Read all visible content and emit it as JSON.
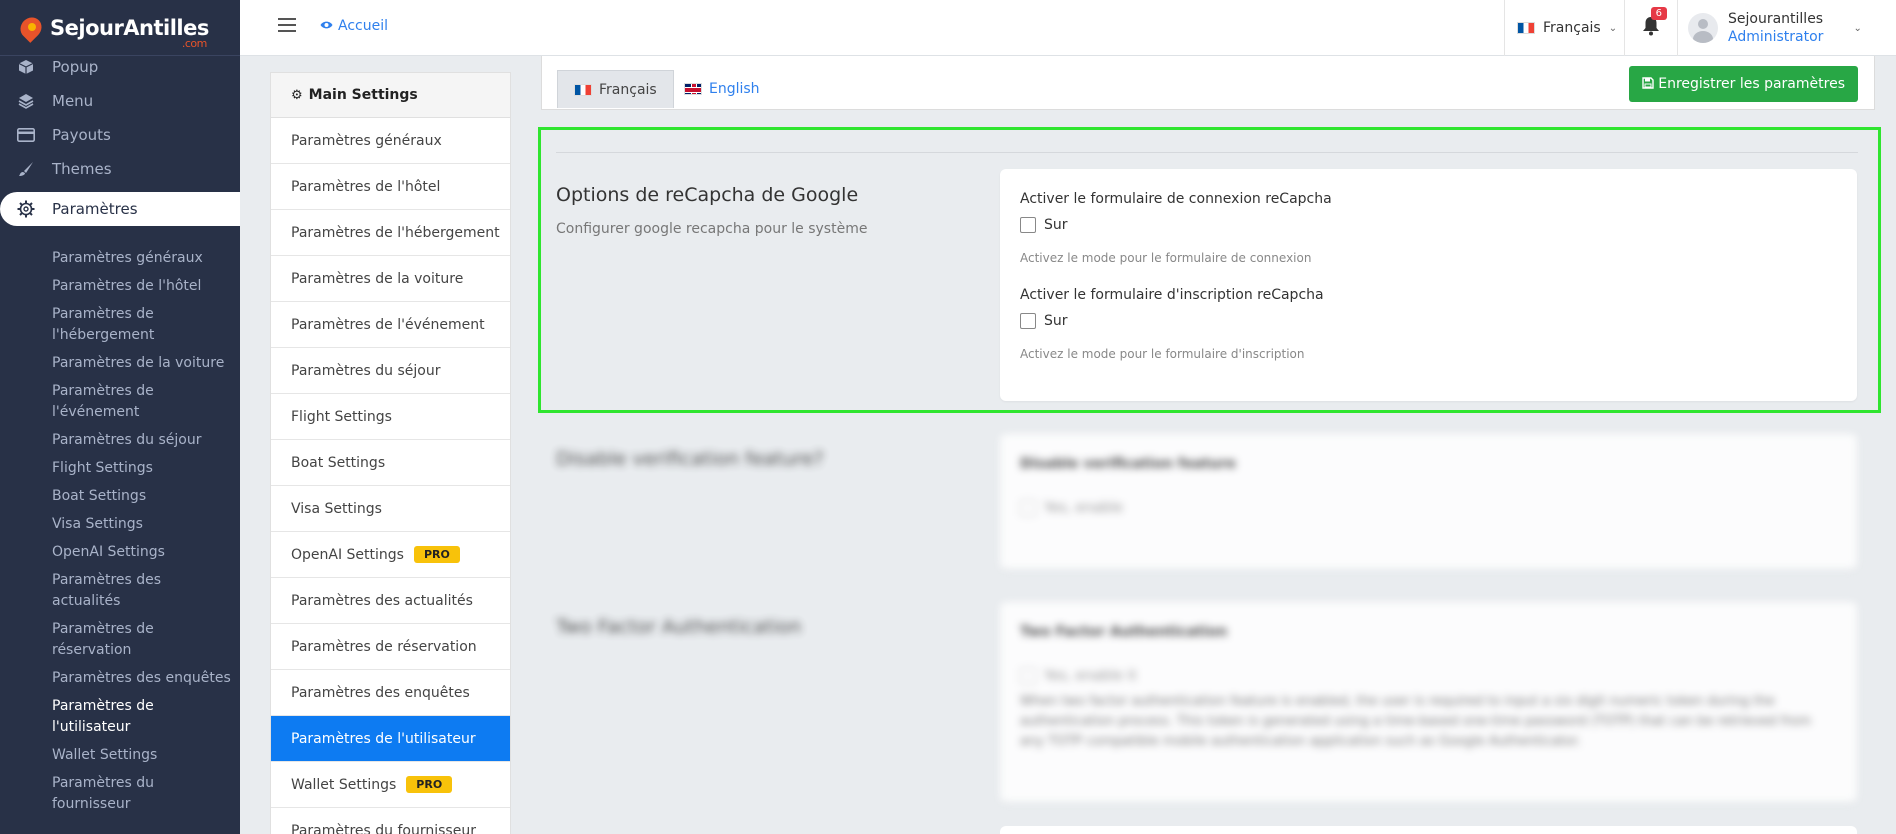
{
  "brand": {
    "name": "SejourAntilles",
    "suffix": ".com"
  },
  "sidebar": {
    "top_items": [
      {
        "label": "Popup",
        "icon": "cube-icon"
      },
      {
        "label": "Menu",
        "icon": "layers-icon"
      },
      {
        "label": "Payouts",
        "icon": "credit-card-icon"
      },
      {
        "label": "Themes",
        "icon": "brush-icon"
      }
    ],
    "active_item": {
      "label": "Paramètres",
      "icon": "gear-icon"
    },
    "sub_items": [
      "Paramètres généraux",
      "Paramètres de l'hôtel",
      "Paramètres de l'hébergement",
      "Paramètres de la voiture",
      "Paramètres de l'événement",
      "Paramètres du séjour",
      "Flight Settings",
      "Boat Settings",
      "Visa Settings",
      "OpenAI Settings",
      "Paramètres des actualités",
      "Paramètres de réservation",
      "Paramètres des enquêtes",
      "Paramètres de l'utilisateur",
      "Wallet Settings",
      "Paramètres du fournisseur"
    ]
  },
  "topbar": {
    "home_label": "Accueil",
    "language": "Français",
    "notifications_count": "6",
    "user_name": "Sejourantilles",
    "user_role": "Administrator"
  },
  "settings_menu": {
    "header": "Main Settings",
    "items": [
      {
        "label": "Paramètres généraux"
      },
      {
        "label": "Paramètres de l'hôtel"
      },
      {
        "label": "Paramètres de l'hébergement"
      },
      {
        "label": "Paramètres de la voiture"
      },
      {
        "label": "Paramètres de l'événement"
      },
      {
        "label": "Paramètres du séjour"
      },
      {
        "label": "Flight Settings"
      },
      {
        "label": "Boat Settings"
      },
      {
        "label": "Visa Settings"
      },
      {
        "label": "OpenAI Settings",
        "badge": "PRO"
      },
      {
        "label": "Paramètres des actualités"
      },
      {
        "label": "Paramètres de réservation"
      },
      {
        "label": "Paramètres des enquêtes"
      },
      {
        "label": "Paramètres de l'utilisateur",
        "active": true
      },
      {
        "label": "Wallet Settings",
        "badge": "PRO"
      },
      {
        "label": "Paramètres du fournisseur"
      }
    ]
  },
  "panel": {
    "tabs": [
      "Français",
      "English"
    ],
    "save_label": "Enregistrer les paramètres",
    "recaptcha": {
      "title": "Options de reCapcha de Google",
      "desc": "Configurer google recapcha pour le système",
      "login_label": "Activer le formulaire de connexion reCapcha",
      "login_check": "Sur",
      "login_help": "Activez le mode pour le formulaire de connexion",
      "register_label": "Activer le formulaire d'inscription reCapcha",
      "register_check": "Sur",
      "register_help": "Activez le mode pour le formulaire d'inscription"
    },
    "verification": {
      "title": "Disable verification feature?",
      "label": "Disable verification feature",
      "check": "Yes, enable"
    },
    "two_factor": {
      "title": "Two Factor Authentication",
      "label": "Two Factor Authentication",
      "check": "Yes, enable it",
      "help": "When two factor authentication feature is enabled, the user is required to input a six digit numeric token during the authentication process. This token is generated using a time-based one-time password (TOTP) that can be retrieved from any TOTP compatible mobile authentication application such as Google Authenticator."
    }
  },
  "colors": {
    "sidebar": "#283147",
    "accent": "#0d7bf2",
    "save": "#28a745",
    "pro_badge": "#f8c20a",
    "highlight": "#2fe52f"
  }
}
